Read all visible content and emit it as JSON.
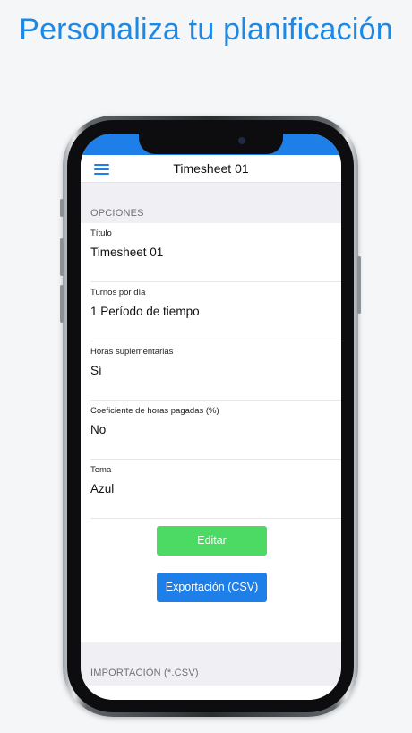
{
  "headline": "Personaliza tu planificación",
  "nav": {
    "title": "Timesheet 01"
  },
  "sections": {
    "options": "OPCIONES",
    "import": "IMPORTACIÓN (*.CSV)"
  },
  "fields": [
    {
      "label": "Título",
      "value": "Timesheet 01"
    },
    {
      "label": "Turnos por día",
      "value": "1 Período de tiempo"
    },
    {
      "label": "Horas suplementarias",
      "value": "Sí"
    },
    {
      "label": "Coeficiente de horas pagadas (%)",
      "value": "No"
    },
    {
      "label": "Tema",
      "value": "Azul"
    }
  ],
  "buttons": {
    "edit": "Editar",
    "export": "Exportación (CSV)"
  },
  "colors": {
    "accent": "#1f7fe8",
    "edit": "#4cd964",
    "headline": "#1e88e5"
  },
  "icons": {
    "menu": "hamburger-menu-icon"
  }
}
